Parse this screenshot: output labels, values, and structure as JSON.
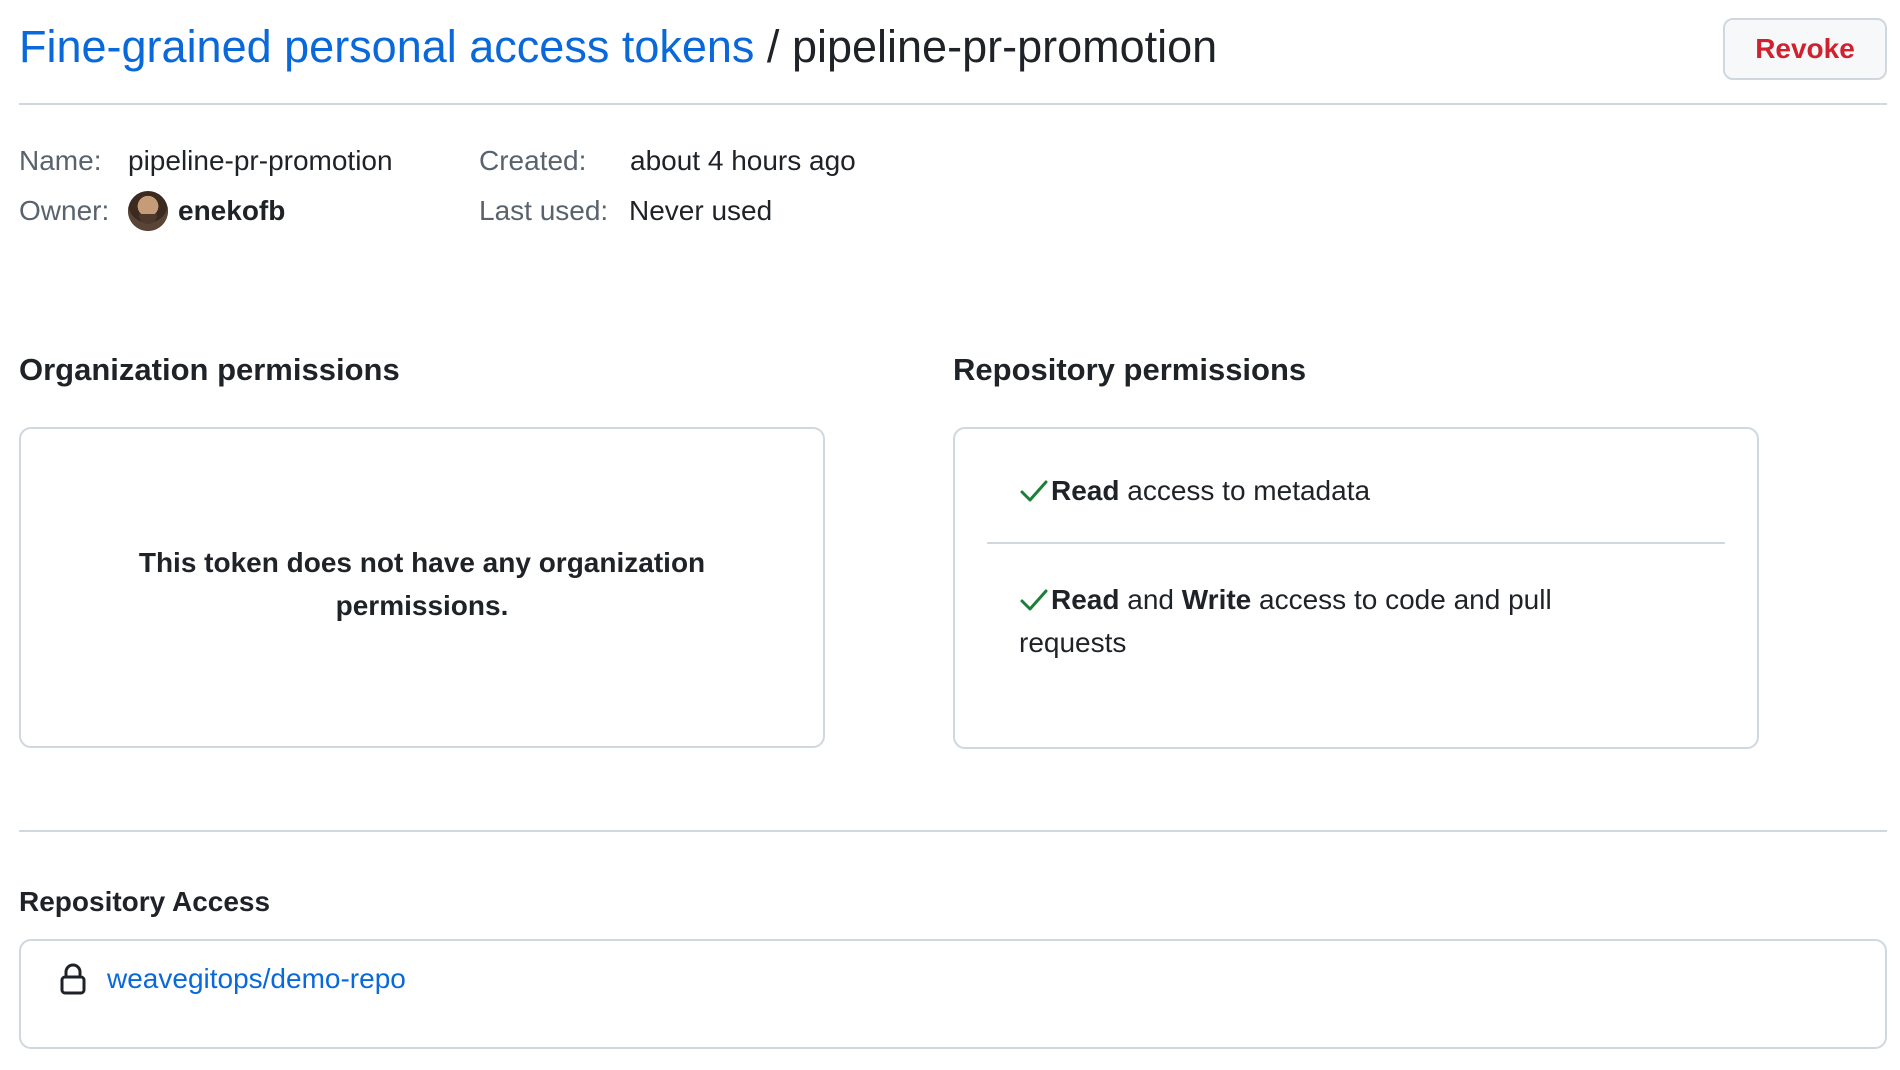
{
  "header": {
    "breadcrumb_link": "Fine-grained personal access tokens",
    "separator": "/",
    "token_name": "pipeline-pr-promotion",
    "revoke_label": "Revoke"
  },
  "meta": {
    "name_label": "Name:",
    "name_value": "pipeline-pr-promotion",
    "created_label": "Created:",
    "created_value": "about 4 hours ago",
    "owner_label": "Owner:",
    "owner_value": "enekofb",
    "last_used_label": "Last used:",
    "last_used_value": "Never used"
  },
  "organization_permissions": {
    "title": "Organization permissions",
    "empty_message": "This token does not have any organization permissions."
  },
  "repository_permissions": {
    "title": "Repository permissions",
    "items": [
      {
        "strong_1": "Read",
        "text_1": " access to metadata"
      },
      {
        "strong_1": "Read",
        "connector": " and ",
        "strong_2": "Write",
        "text_1": " access to code and pull",
        "text_2": "requests"
      }
    ]
  },
  "repository_access": {
    "title": "Repository Access",
    "repo": "weavegitops/demo-repo"
  },
  "colors": {
    "link": "#0969da",
    "danger": "#cf222e",
    "success": "#1a7f37",
    "border": "#d0d7de"
  },
  "icons": {
    "check": "check-icon",
    "lock": "lock-icon",
    "avatar": "avatar"
  }
}
